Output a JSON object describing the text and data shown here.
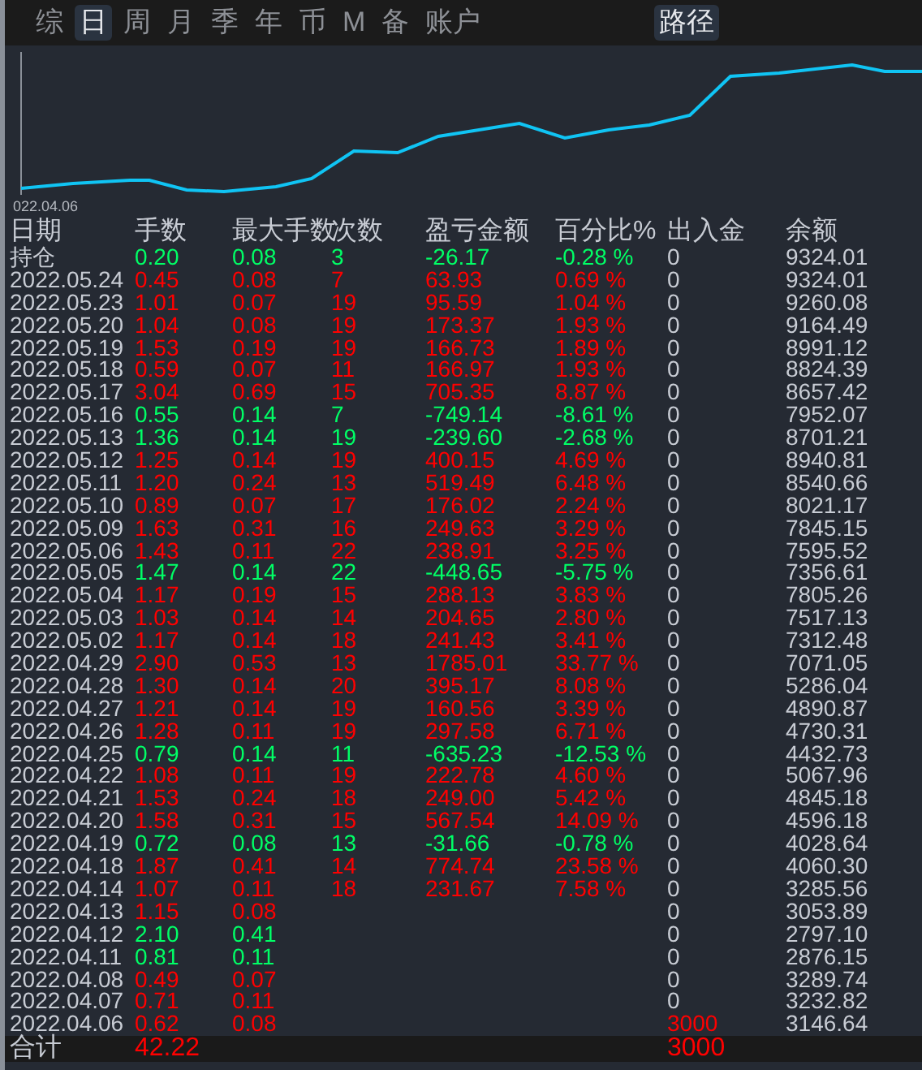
{
  "tabs": [
    {
      "label": "综",
      "selected": false
    },
    {
      "label": "日",
      "selected": true
    },
    {
      "label": "周",
      "selected": false
    },
    {
      "label": "月",
      "selected": false
    },
    {
      "label": "季",
      "selected": false
    },
    {
      "label": "年",
      "selected": false
    },
    {
      "label": "币",
      "selected": false
    },
    {
      "label": "M",
      "selected": false
    },
    {
      "label": "备",
      "selected": false
    },
    {
      "label": "账户",
      "selected": false
    }
  ],
  "path_button": {
    "label": "路径",
    "selected": true
  },
  "chart": {
    "start_label": "022.04.06"
  },
  "table": {
    "columns": [
      "日期",
      "手数",
      "最大手数",
      "次数",
      "盈亏金额",
      "百分比%",
      "出入金",
      "余额"
    ],
    "rows": [
      {
        "date": "持仓",
        "lots": "0.20",
        "max_lots": "0.08",
        "count": "3",
        "pnl": "-26.17",
        "pct": "-0.28 %",
        "deposit": "0",
        "balance": "9324.01",
        "color": "#00ff66"
      },
      {
        "date": "2022.05.24",
        "lots": "0.45",
        "max_lots": "0.08",
        "count": "7",
        "pnl": "63.93",
        "pct": "0.69 %",
        "deposit": "0",
        "balance": "9324.01",
        "color": "#ff0000"
      },
      {
        "date": "2022.05.23",
        "lots": "1.01",
        "max_lots": "0.07",
        "count": "19",
        "pnl": "95.59",
        "pct": "1.04 %",
        "deposit": "0",
        "balance": "9260.08",
        "color": "#ff0000"
      },
      {
        "date": "2022.05.20",
        "lots": "1.04",
        "max_lots": "0.08",
        "count": "19",
        "pnl": "173.37",
        "pct": "1.93 %",
        "deposit": "0",
        "balance": "9164.49",
        "color": "#ff0000"
      },
      {
        "date": "2022.05.19",
        "lots": "1.53",
        "max_lots": "0.19",
        "count": "19",
        "pnl": "166.73",
        "pct": "1.89 %",
        "deposit": "0",
        "balance": "8991.12",
        "color": "#ff0000"
      },
      {
        "date": "2022.05.18",
        "lots": "0.59",
        "max_lots": "0.07",
        "count": "11",
        "pnl": "166.97",
        "pct": "1.93 %",
        "deposit": "0",
        "balance": "8824.39",
        "color": "#ff0000"
      },
      {
        "date": "2022.05.17",
        "lots": "3.04",
        "max_lots": "0.69",
        "count": "15",
        "pnl": "705.35",
        "pct": "8.87 %",
        "deposit": "0",
        "balance": "8657.42",
        "color": "#ff0000"
      },
      {
        "date": "2022.05.16",
        "lots": "0.55",
        "max_lots": "0.14",
        "count": "7",
        "pnl": "-749.14",
        "pct": "-8.61 %",
        "deposit": "0",
        "balance": "7952.07",
        "color": "#00ff66"
      },
      {
        "date": "2022.05.13",
        "lots": "1.36",
        "max_lots": "0.14",
        "count": "19",
        "pnl": "-239.60",
        "pct": "-2.68 %",
        "deposit": "0",
        "balance": "8701.21",
        "color": "#00ff66"
      },
      {
        "date": "2022.05.12",
        "lots": "1.25",
        "max_lots": "0.14",
        "count": "19",
        "pnl": "400.15",
        "pct": "4.69 %",
        "deposit": "0",
        "balance": "8940.81",
        "color": "#ff0000"
      },
      {
        "date": "2022.05.11",
        "lots": "1.20",
        "max_lots": "0.24",
        "count": "13",
        "pnl": "519.49",
        "pct": "6.48 %",
        "deposit": "0",
        "balance": "8540.66",
        "color": "#ff0000"
      },
      {
        "date": "2022.05.10",
        "lots": "0.89",
        "max_lots": "0.07",
        "count": "17",
        "pnl": "176.02",
        "pct": "2.24 %",
        "deposit": "0",
        "balance": "8021.17",
        "color": "#ff0000"
      },
      {
        "date": "2022.05.09",
        "lots": "1.63",
        "max_lots": "0.31",
        "count": "16",
        "pnl": "249.63",
        "pct": "3.29 %",
        "deposit": "0",
        "balance": "7845.15",
        "color": "#ff0000"
      },
      {
        "date": "2022.05.06",
        "lots": "1.43",
        "max_lots": "0.11",
        "count": "22",
        "pnl": "238.91",
        "pct": "3.25 %",
        "deposit": "0",
        "balance": "7595.52",
        "color": "#ff0000"
      },
      {
        "date": "2022.05.05",
        "lots": "1.47",
        "max_lots": "0.14",
        "count": "22",
        "pnl": "-448.65",
        "pct": "-5.75 %",
        "deposit": "0",
        "balance": "7356.61",
        "color": "#00ff66"
      },
      {
        "date": "2022.05.04",
        "lots": "1.17",
        "max_lots": "0.19",
        "count": "15",
        "pnl": "288.13",
        "pct": "3.83 %",
        "deposit": "0",
        "balance": "7805.26",
        "color": "#ff0000"
      },
      {
        "date": "2022.05.03",
        "lots": "1.03",
        "max_lots": "0.14",
        "count": "14",
        "pnl": "204.65",
        "pct": "2.80 %",
        "deposit": "0",
        "balance": "7517.13",
        "color": "#ff0000"
      },
      {
        "date": "2022.05.02",
        "lots": "1.17",
        "max_lots": "0.14",
        "count": "18",
        "pnl": "241.43",
        "pct": "3.41 %",
        "deposit": "0",
        "balance": "7312.48",
        "color": "#ff0000"
      },
      {
        "date": "2022.04.29",
        "lots": "2.90",
        "max_lots": "0.53",
        "count": "13",
        "pnl": "1785.01",
        "pct": "33.77 %",
        "deposit": "0",
        "balance": "7071.05",
        "color": "#ff0000"
      },
      {
        "date": "2022.04.28",
        "lots": "1.30",
        "max_lots": "0.14",
        "count": "20",
        "pnl": "395.17",
        "pct": "8.08 %",
        "deposit": "0",
        "balance": "5286.04",
        "color": "#ff0000"
      },
      {
        "date": "2022.04.27",
        "lots": "1.21",
        "max_lots": "0.14",
        "count": "19",
        "pnl": "160.56",
        "pct": "3.39 %",
        "deposit": "0",
        "balance": "4890.87",
        "color": "#ff0000"
      },
      {
        "date": "2022.04.26",
        "lots": "1.28",
        "max_lots": "0.11",
        "count": "19",
        "pnl": "297.58",
        "pct": "6.71 %",
        "deposit": "0",
        "balance": "4730.31",
        "color": "#ff0000"
      },
      {
        "date": "2022.04.25",
        "lots": "0.79",
        "max_lots": "0.14",
        "count": "11",
        "pnl": "-635.23",
        "pct": "-12.53 %",
        "deposit": "0",
        "balance": "4432.73",
        "color": "#00ff66"
      },
      {
        "date": "2022.04.22",
        "lots": "1.08",
        "max_lots": "0.11",
        "count": "19",
        "pnl": "222.78",
        "pct": "4.60 %",
        "deposit": "0",
        "balance": "5067.96",
        "color": "#ff0000"
      },
      {
        "date": "2022.04.21",
        "lots": "1.53",
        "max_lots": "0.24",
        "count": "18",
        "pnl": "249.00",
        "pct": "5.42 %",
        "deposit": "0",
        "balance": "4845.18",
        "color": "#ff0000"
      },
      {
        "date": "2022.04.20",
        "lots": "1.58",
        "max_lots": "0.31",
        "count": "15",
        "pnl": "567.54",
        "pct": "14.09 %",
        "deposit": "0",
        "balance": "4596.18",
        "color": "#ff0000"
      },
      {
        "date": "2022.04.19",
        "lots": "0.72",
        "max_lots": "0.08",
        "count": "13",
        "pnl": "-31.66",
        "pct": "-0.78 %",
        "deposit": "0",
        "balance": "4028.64",
        "color": "#00ff66"
      },
      {
        "date": "2022.04.18",
        "lots": "1.87",
        "max_lots": "0.41",
        "count": "14",
        "pnl": "774.74",
        "pct": "23.58 %",
        "deposit": "0",
        "balance": "4060.30",
        "color": "#ff0000"
      },
      {
        "date": "2022.04.14",
        "lots": "1.07",
        "max_lots": "0.11",
        "count": "18",
        "pnl": "231.67",
        "pct": "7.58 %",
        "deposit": "0",
        "balance": "3285.56",
        "color": "#ff0000"
      },
      {
        "date": "2022.04.13",
        "lots": "1.15",
        "max_lots": "0.08",
        "deposit": "0",
        "balance": "3053.89",
        "color": "#ff0000"
      },
      {
        "date": "2022.04.12",
        "lots": "2.10",
        "max_lots": "0.41",
        "deposit": "0",
        "balance": "2797.10",
        "color": "#00ff66"
      },
      {
        "date": "2022.04.11",
        "lots": "0.81",
        "max_lots": "0.11",
        "deposit": "0",
        "balance": "2876.15",
        "color": "#00ff66"
      },
      {
        "date": "2022.04.08",
        "lots": "0.49",
        "max_lots": "0.07",
        "deposit": "0",
        "balance": "3289.74",
        "color": "#ff0000"
      },
      {
        "date": "2022.04.07",
        "lots": "0.71",
        "max_lots": "0.11",
        "deposit": "0",
        "balance": "3232.82",
        "color": "#ff0000"
      },
      {
        "date": "2022.04.06",
        "lots": "0.62",
        "max_lots": "0.08",
        "deposit": {
          "text": "3000",
          "color": "#ff0000"
        },
        "balance": "3146.64",
        "color": "#ff0000"
      }
    ],
    "total": {
      "date": "合计",
      "lots": "42.22",
      "deposit": {
        "text": "3000",
        "color": "#ff0000"
      },
      "color": "#ff0000"
    }
  }
}
